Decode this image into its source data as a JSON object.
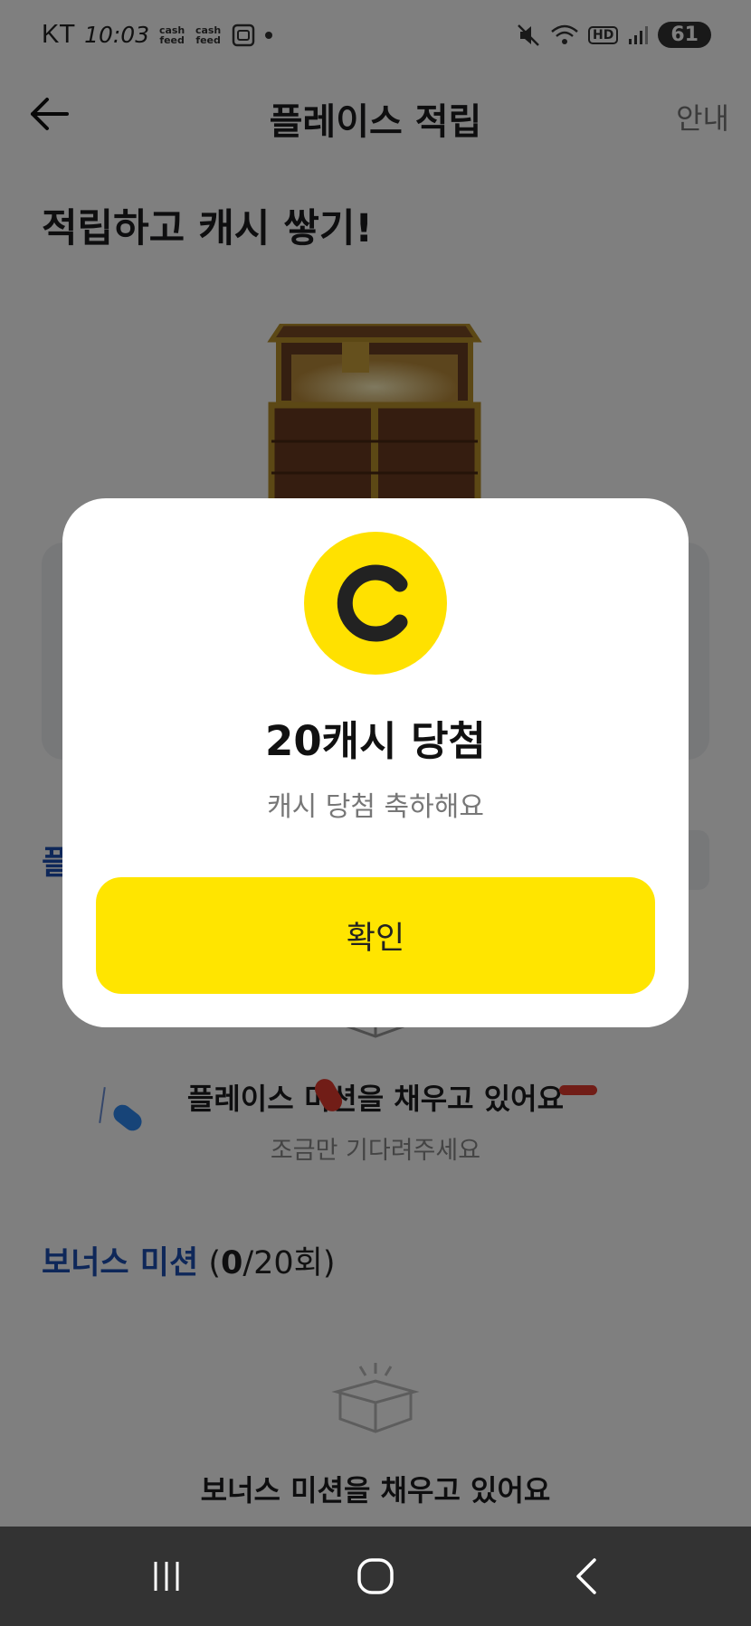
{
  "status_bar": {
    "carrier": "KT",
    "time": "10:03",
    "app_label_1": "cash feed",
    "app_label_2": "cash feed",
    "hd": "HD",
    "battery": "61"
  },
  "header": {
    "title": "플레이스 적립",
    "guide_label": "안내"
  },
  "headline": "적립하고 캐시 쌓기!",
  "section1": {
    "title_partial": "플",
    "empty_title": "플레이스 미션을 채우고 있어요",
    "empty_sub": "조금만 기다려주세요"
  },
  "bonus": {
    "name": "보너스 미션",
    "count_open": " (",
    "count_value": "0",
    "count_total": "/20회)",
    "empty_title": "보너스 미션을 채우고 있어요"
  },
  "modal": {
    "coin_letter": "C",
    "title": "20캐시 당첨",
    "subtitle": "캐시 당첨 축하해요",
    "confirm_label": "확인"
  },
  "colors": {
    "accent_yellow": "#ffe500",
    "section_blue": "#1d4fb3",
    "overlay": "rgba(0,0,0,0.5)",
    "nav_bar": "#333333"
  },
  "icons": [
    "back-arrow-icon",
    "treasure-chest-icon",
    "empty-box-icon",
    "recent-apps-icon",
    "home-icon",
    "back-icon"
  ]
}
